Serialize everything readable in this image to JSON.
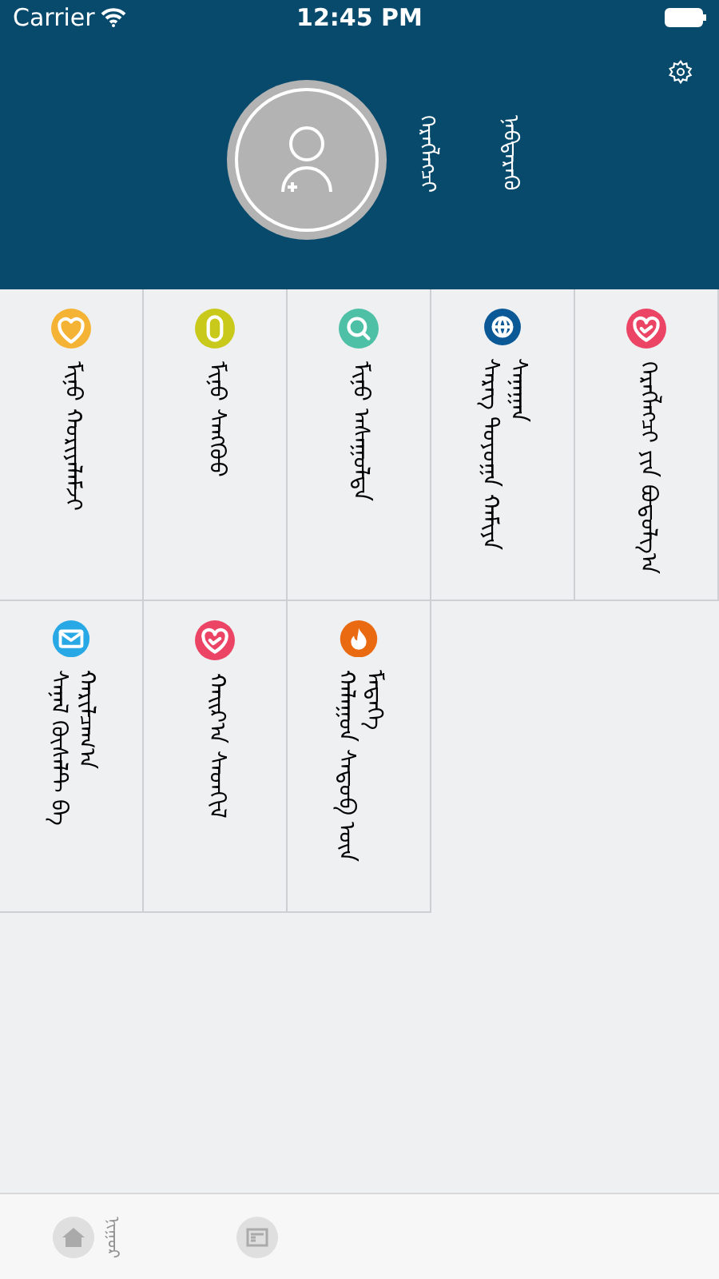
{
  "status_bar": {
    "carrier": "Carrier",
    "time": "12:45 PM"
  },
  "profile": {
    "name": "ᠬᠡᠷᠡᠭᠯᠡᠭᠴᠢ",
    "action": "ᠨᠡᠪᠲᠡᠷᠡᠬᠦ"
  },
  "menu": [
    {
      "label": "ᠮᠢᠨᠦ ᠬᠤᠷᠢᠶᠠᠯᠠᠮᠵᠢ",
      "color": "#f5b335"
    },
    {
      "label": "ᠮᠢᠨᠦ ᠰᠠᠩᠬᠦᠦ",
      "color": "#c9c91c"
    },
    {
      "label": "ᠮᠢᠨᠦ ᠠᠰᠠᠭᠤᠯᠲᠠ",
      "color": "#4dc0a6"
    },
    {
      "label": "ᠰᠡᠷᠡᠭ ᠲᠤᠶᠤᠭᠠ ᠬᠠᠮᠢᠶᠠ ᠰᠠᠨᠠᠭᠠᠨ",
      "color": "#0b5896"
    },
    {
      "label": "ᠬᠡᠷᠡᠭᠯᠡᠭᠴᠢ ᠶᠢᠨ ᠪᠣᠳᠣᠯᠭ᠎ᠠ",
      "color": "#ec4465"
    },
    {
      "label": "ᠰᠠᠨᠠᠯ ᠬᠦᠰᠡᠯᠲ ᠪᠠ ᠬᠠᠷᠢᠯᠴᠠᠭ᠎ᠠ",
      "color": "#29a8e6"
    },
    {
      "label": "ᠬᠠᠢᠷ᠎ᠠ ᠰᠡᠳᠬᠢᠯ",
      "color": "#ec4465"
    },
    {
      "label": "ᠬᠠᠯᠠᠭᠤᠨ ᠰᠡᠳᠦᠪ ᠦᠨ ᠮᠡᠳᠡᠭᠡ",
      "color": "#ea6a12"
    }
  ],
  "tab_bar": [
    {
      "label": "ᠨᠢᠭᠤᠷ",
      "selected": false
    },
    {
      "selected": false
    }
  ]
}
